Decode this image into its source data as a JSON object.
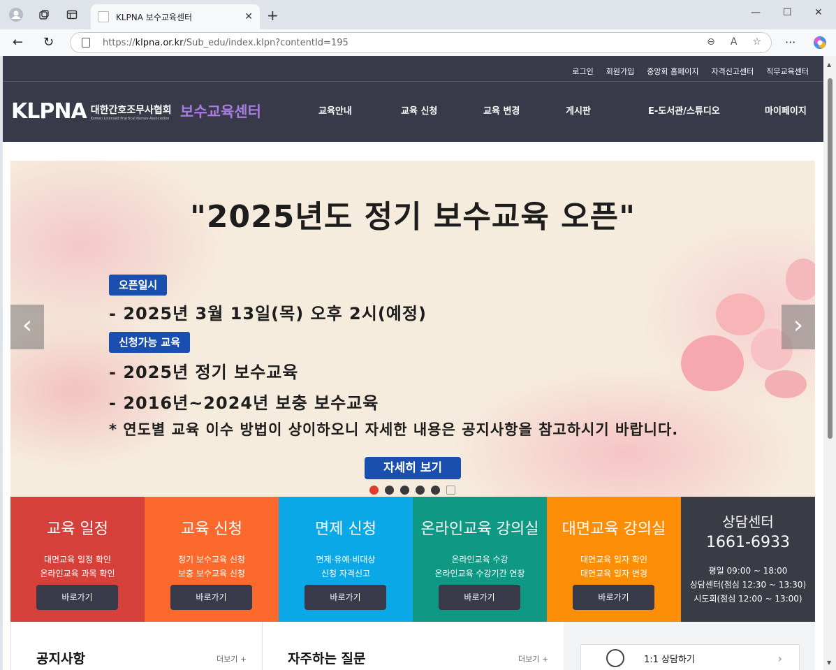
{
  "browser": {
    "tab_title": "KLPNA 보수교육센터",
    "url_prefix": "https://",
    "url_domain": "klpna.or.kr",
    "url_path": "/Sub_edu/index.klpn?contentId=195"
  },
  "header": {
    "util_links": [
      "로그인",
      "회원가입",
      "중앙회 홈페이지",
      "자격신고센터",
      "직무교육센터"
    ],
    "logo_mark": "KLPNA",
    "logo_ko": "대한간호조무사협회",
    "logo_en": "Korean Licensed Practical Nurses Association",
    "site_title": "보수교육센터",
    "gnb": [
      "교육안내",
      "교육 신청",
      "교육 변경",
      "게시판",
      "E-도서관/스튜디오",
      "마이페이지"
    ]
  },
  "banner": {
    "title": "\"2025년도 정기 보수교육 오픈\"",
    "badge_open": "오픈일시",
    "open_line": "- 2025년 3월 13일(목) 오후 2시(예정)",
    "badge_edu": "신청가능 교육",
    "edu_line1": "- 2025년 정기 보수교육",
    "edu_line2": "- 2016년~2024년 보충 보수교육",
    "note": "* 연도별 교육 이수 방법이 상이하오니 자세한 내용은 공지사항을 참고하시기 바랍니다.",
    "detail_button": "자세히 보기",
    "slide_count": 5,
    "active_slide": 1
  },
  "quick_menu": [
    {
      "title": "교육 일정",
      "desc1": "대면교육 일정 확인",
      "desc2": "온라인교육 과목 확인",
      "button": "바로가기",
      "color": "#d5413a"
    },
    {
      "title": "교육 신청",
      "desc1": "정기 보수교육 신청",
      "desc2": "보충 보수교육 신청",
      "button": "바로가기",
      "color": "#fb6a2c"
    },
    {
      "title": "면제 신청",
      "desc1": "면제·유예·비대상",
      "desc2": "신청 자격신고",
      "button": "바로가기",
      "color": "#0aa8e6"
    },
    {
      "title": "온라인교육 강의실",
      "desc1": "온라인교육 수강",
      "desc2": "온라인교육 수강기간 연장",
      "button": "바로가기",
      "color": "#0f9884"
    },
    {
      "title": "대면교육 강의실",
      "desc1": "대면교육 일자 확인",
      "desc2": "대면교육 일자 변경",
      "button": "바로가기",
      "color": "#fb8e06"
    }
  ],
  "counsel": {
    "title": "상담센터",
    "phone": "1661-6933",
    "hours1": "평일 09:00 ~ 18:00",
    "hours2": "상담센터(점심 12:30 ~ 13:30)",
    "hours3": "시도회(점심 12:00 ~ 13:00)"
  },
  "bottom": {
    "notice_title": "공지사항",
    "notice_more": "더보기 +",
    "faq_title": "자주하는 질문",
    "faq_more": "더보기 +",
    "consult_label": "1:1 상담하기"
  }
}
